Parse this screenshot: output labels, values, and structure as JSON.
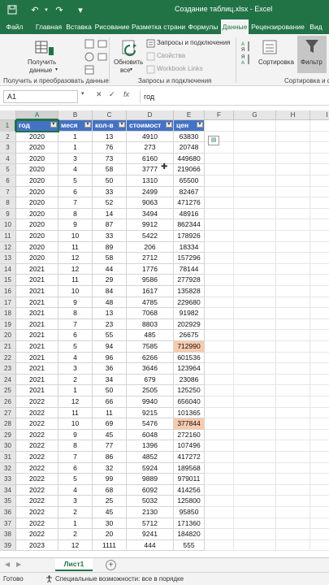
{
  "titlebar": {
    "title": "Создание таблиц.xlsx  -  Excel"
  },
  "tabs": [
    "Файл",
    "Главная",
    "Вставка",
    "Рисование",
    "Разметка страни",
    "Формулы",
    "Данные",
    "Рецензирование",
    "Вид"
  ],
  "active_tab": 6,
  "ribbon": {
    "get_data": [
      "Получить",
      "данные"
    ],
    "refresh": [
      "Обновить",
      "все"
    ],
    "queries": "Запросы и подключения",
    "properties": "Свойства",
    "workbook_links": "Workbook Links",
    "sort": "Сортировка",
    "filter": "Фильтр",
    "group_get": "Получить и преобразовать данные",
    "group_queries": "Запросы и подключения",
    "group_sort": "Сортировка и ф"
  },
  "formula_bar": {
    "cell_ref": "A1",
    "fx": "fx",
    "value": "год"
  },
  "columns": [
    "A",
    "B",
    "C",
    "D",
    "E",
    "F",
    "G",
    "H",
    "I"
  ],
  "header_row": [
    "год",
    "меся",
    "кол-в",
    "стоимост",
    "цен"
  ],
  "rows": [
    [
      "2020",
      "1",
      "13",
      "4910",
      "63830"
    ],
    [
      "2020",
      "1",
      "76",
      "273",
      "20748"
    ],
    [
      "2020",
      "3",
      "73",
      "6160",
      "449680"
    ],
    [
      "2020",
      "4",
      "58",
      "3777",
      "219066"
    ],
    [
      "2020",
      "5",
      "50",
      "1310",
      "65500"
    ],
    [
      "2020",
      "6",
      "33",
      "2499",
      "82467"
    ],
    [
      "2020",
      "7",
      "52",
      "9063",
      "471276"
    ],
    [
      "2020",
      "8",
      "14",
      "3494",
      "48916"
    ],
    [
      "2020",
      "9",
      "87",
      "9912",
      "862344"
    ],
    [
      "2020",
      "10",
      "33",
      "5422",
      "178926"
    ],
    [
      "2020",
      "11",
      "89",
      "206",
      "18334"
    ],
    [
      "2020",
      "12",
      "58",
      "2712",
      "157296"
    ],
    [
      "2021",
      "12",
      "44",
      "1776",
      "78144"
    ],
    [
      "2021",
      "11",
      "29",
      "9586",
      "277928"
    ],
    [
      "2021",
      "10",
      "84",
      "1617",
      "135828"
    ],
    [
      "2021",
      "9",
      "48",
      "4785",
      "229680"
    ],
    [
      "2021",
      "8",
      "13",
      "7068",
      "91982"
    ],
    [
      "2021",
      "7",
      "23",
      "8803",
      "202929"
    ],
    [
      "2021",
      "6",
      "55",
      "485",
      "26675"
    ],
    [
      "2021",
      "5",
      "94",
      "7585",
      "712990"
    ],
    [
      "2021",
      "4",
      "96",
      "6266",
      "601536"
    ],
    [
      "2021",
      "3",
      "36",
      "3646",
      "123964"
    ],
    [
      "2021",
      "2",
      "34",
      "679",
      "23086"
    ],
    [
      "2021",
      "1",
      "50",
      "2505",
      "125250"
    ],
    [
      "2022",
      "12",
      "66",
      "9940",
      "656040"
    ],
    [
      "2022",
      "11",
      "11",
      "9215",
      "101365"
    ],
    [
      "2022",
      "10",
      "69",
      "5476",
      "377844"
    ],
    [
      "2022",
      "9",
      "45",
      "6048",
      "272160"
    ],
    [
      "2022",
      "8",
      "77",
      "1396",
      "107496"
    ],
    [
      "2022",
      "7",
      "86",
      "4852",
      "417272"
    ],
    [
      "2022",
      "6",
      "32",
      "5924",
      "189568"
    ],
    [
      "2022",
      "5",
      "99",
      "9889",
      "979011"
    ],
    [
      "2022",
      "4",
      "68",
      "6092",
      "414256"
    ],
    [
      "2022",
      "3",
      "25",
      "5032",
      "125800"
    ],
    [
      "2022",
      "2",
      "45",
      "2130",
      "95850"
    ],
    [
      "2022",
      "1",
      "30",
      "5712",
      "171360"
    ],
    [
      "2022",
      "2",
      "20",
      "9241",
      "184820"
    ],
    [
      "2023",
      "12",
      "1111",
      "444",
      "555"
    ]
  ],
  "highlighted_cells": [
    "E21",
    "E28"
  ],
  "sheet_tab": "Лист1",
  "status": {
    "ready": "Готово",
    "accessibility": "Специальные возможности: все в порядке"
  }
}
